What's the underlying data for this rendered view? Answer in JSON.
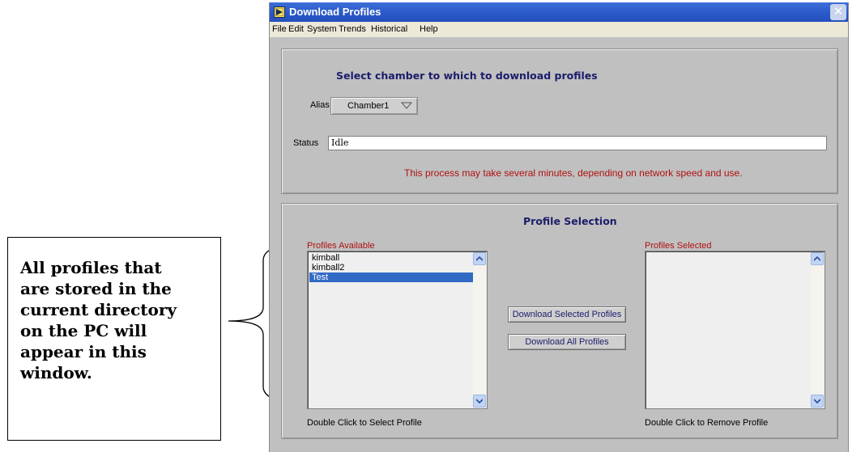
{
  "callout": {
    "text": "All profiles that\nare stored in the\ncurrent directory\non the PC will\nappear in this\nwindow."
  },
  "window": {
    "title": "Download Profiles",
    "close_glyph": "✕",
    "menu": [
      "File",
      "Edit",
      "System",
      "Trends",
      "Historical",
      "Help"
    ]
  },
  "chamber_section": {
    "title": "Select chamber to which to download profiles",
    "alias_label": "Alias",
    "alias_value": "Chamber1",
    "status_label": "Status",
    "status_value": "Idle",
    "note": "This process may take several minutes, depending on network speed and use."
  },
  "profile_section": {
    "title": "Profile Selection",
    "available_label": "Profiles Available",
    "available_items": [
      "kimball",
      "kimball2",
      "Test"
    ],
    "selected_item_index": 2,
    "available_hint": "Double Click to Select Profile",
    "selected_label": "Profiles Selected",
    "selected_items": [],
    "selected_hint": "Double Click to Remove Profile",
    "download_selected_label": "Download Selected Profiles",
    "download_all_label": "Download All Profiles"
  },
  "icons": {
    "window_icon": "labview-run-arrow-icon",
    "dropdown_icon": "chevron-down-icon",
    "scroll_up_icon": "scroll-up-arrow-icon",
    "scroll_down_icon": "scroll-down-arrow-icon",
    "brace_icon": "curly-brace-icon"
  },
  "colors": {
    "titlebar": "#2a57c7",
    "selection": "#316ac5",
    "section_title": "#1c1c6b",
    "red_text": "#b01010",
    "panel_bg": "#c0c0c0"
  }
}
